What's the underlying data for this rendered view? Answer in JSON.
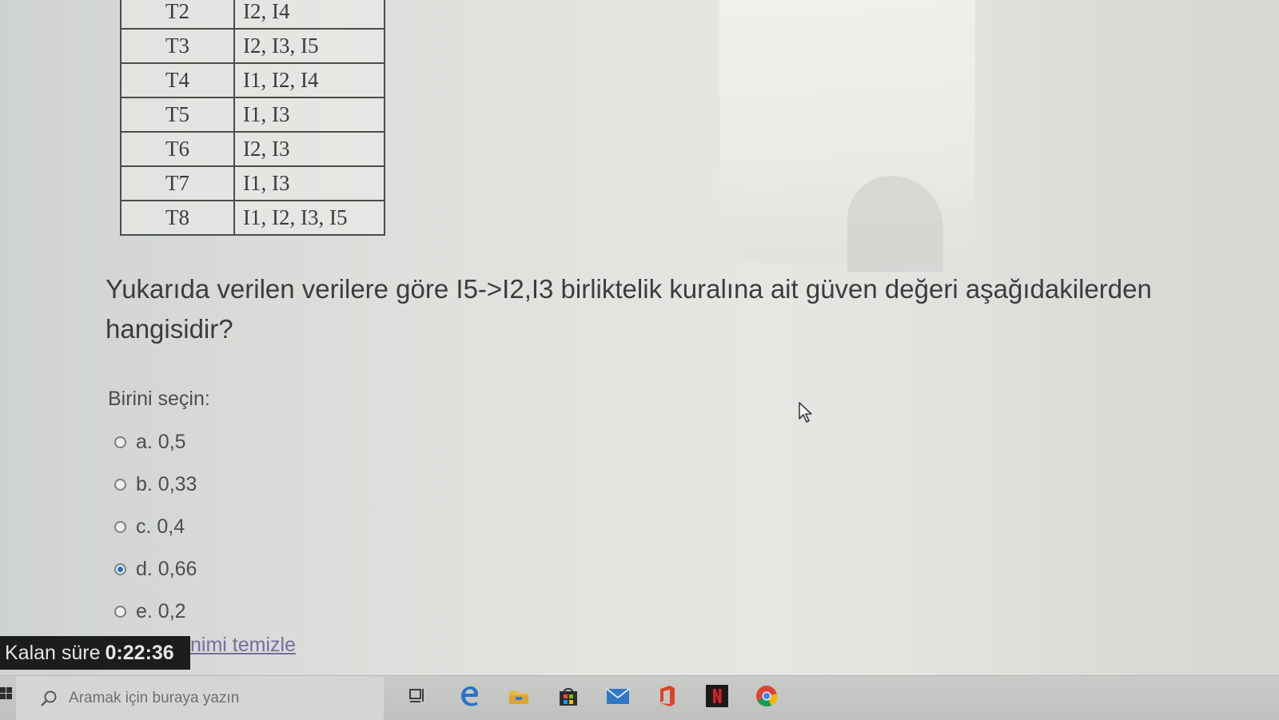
{
  "table": {
    "rows": [
      {
        "tid": "T2",
        "items": "I2, I4"
      },
      {
        "tid": "T3",
        "items": "I2, I3, I5"
      },
      {
        "tid": "T4",
        "items": "I1, I2, I4"
      },
      {
        "tid": "T5",
        "items": "I1, I3"
      },
      {
        "tid": "T6",
        "items": "I2, I3"
      },
      {
        "tid": "T7",
        "items": "I1, I3"
      },
      {
        "tid": "T8",
        "items": "I1, I2, I3, I5"
      }
    ]
  },
  "question": {
    "text": "Yukarıda verilen verilere göre I5->I2,I3 birliktelik kuralına ait güven değeri aşağıdakilerden hangisidir?",
    "prompt": "Birini seçin:",
    "options": [
      {
        "label": "a. 0,5",
        "selected": false
      },
      {
        "label": "b. 0,33",
        "selected": false
      },
      {
        "label": "c. 0,4",
        "selected": false
      },
      {
        "label": "d. 0,66",
        "selected": true
      },
      {
        "label": "e. 0,2",
        "selected": false
      }
    ],
    "clear_label": "nimi temizle"
  },
  "timer": {
    "label": "Kalan süre",
    "value": "0:22:36"
  },
  "taskbar": {
    "search_placeholder": "Aramak için buraya yazın",
    "icons": [
      "task-view-icon",
      "edge-icon",
      "file-explorer-icon",
      "store-icon",
      "mail-icon",
      "office-icon",
      "netflix-icon",
      "chrome-icon"
    ]
  },
  "colors": {
    "selected_radio": "#2f6fb7",
    "link": "#7b6b9d",
    "timer_bg": "#1b1c1c"
  }
}
